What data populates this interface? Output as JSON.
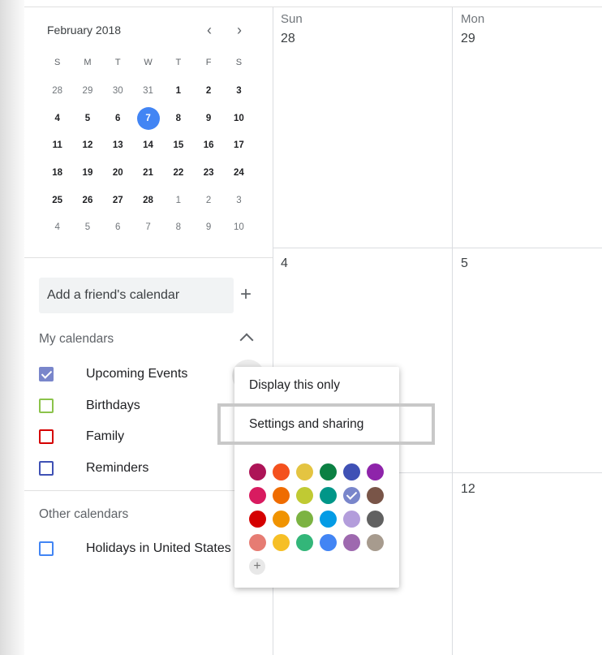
{
  "mini_calendar": {
    "month_label": "February 2018",
    "prev_icon": "chevron-left-icon",
    "next_icon": "chevron-right-icon",
    "weekdays": [
      "S",
      "M",
      "T",
      "W",
      "T",
      "F",
      "S"
    ],
    "weeks": [
      [
        {
          "d": "28",
          "dim": true
        },
        {
          "d": "29",
          "dim": true
        },
        {
          "d": "30",
          "dim": true
        },
        {
          "d": "31",
          "dim": true
        },
        {
          "d": "1"
        },
        {
          "d": "2"
        },
        {
          "d": "3"
        }
      ],
      [
        {
          "d": "4"
        },
        {
          "d": "5"
        },
        {
          "d": "6"
        },
        {
          "d": "7",
          "today": true
        },
        {
          "d": "8"
        },
        {
          "d": "9"
        },
        {
          "d": "10"
        }
      ],
      [
        {
          "d": "11"
        },
        {
          "d": "12"
        },
        {
          "d": "13"
        },
        {
          "d": "14"
        },
        {
          "d": "15"
        },
        {
          "d": "16"
        },
        {
          "d": "17"
        }
      ],
      [
        {
          "d": "18"
        },
        {
          "d": "19"
        },
        {
          "d": "20"
        },
        {
          "d": "21"
        },
        {
          "d": "22"
        },
        {
          "d": "23"
        },
        {
          "d": "24"
        }
      ],
      [
        {
          "d": "25"
        },
        {
          "d": "26"
        },
        {
          "d": "27"
        },
        {
          "d": "28"
        },
        {
          "d": "1",
          "dim": true
        },
        {
          "d": "2",
          "dim": true
        },
        {
          "d": "3",
          "dim": true
        }
      ],
      [
        {
          "d": "4",
          "dim": true
        },
        {
          "d": "5",
          "dim": true
        },
        {
          "d": "6",
          "dim": true
        },
        {
          "d": "7",
          "dim": true
        },
        {
          "d": "8",
          "dim": true
        },
        {
          "d": "9",
          "dim": true
        },
        {
          "d": "10",
          "dim": true
        }
      ]
    ]
  },
  "add_friend": {
    "placeholder": "Add a friend's calendar",
    "plus_label": "+"
  },
  "my_calendars": {
    "title": "My calendars",
    "items": [
      {
        "label": "Upcoming Events",
        "color": "#7986cb",
        "checked": true
      },
      {
        "label": "Birthdays",
        "color": "#8bc34a",
        "checked": false
      },
      {
        "label": "Family",
        "color": "#d50000",
        "checked": false
      },
      {
        "label": "Reminders",
        "color": "#3f51b5",
        "checked": false
      }
    ]
  },
  "other_calendars": {
    "title": "Other calendars",
    "items": [
      {
        "label": "Holidays in United States",
        "color": "#4285f4",
        "checked": false
      }
    ]
  },
  "grid": {
    "headers": [
      {
        "name": "Sun",
        "num": "28"
      },
      {
        "name": "Mon",
        "num": "29"
      }
    ],
    "row2": [
      "4",
      "5"
    ],
    "row3": [
      "12"
    ]
  },
  "menu": {
    "items": [
      "Display this only",
      "Settings and sharing"
    ],
    "colors": [
      [
        "#ad1457",
        "#f4511e",
        "#e4c441",
        "#0b8043",
        "#3f51b5",
        "#8e24aa"
      ],
      [
        "#d81b60",
        "#ef6c00",
        "#c0ca33",
        "#009688",
        "#7986cb",
        "#795548"
      ],
      [
        "#d50000",
        "#f09300",
        "#7cb342",
        "#039be5",
        "#b39ddb",
        "#616161"
      ],
      [
        "#e67c73",
        "#f6bf26",
        "#33b679",
        "#4285f4",
        "#9e69af",
        "#a79b8e"
      ]
    ],
    "selected_color": "#7986cb",
    "add_color_label": "+"
  }
}
